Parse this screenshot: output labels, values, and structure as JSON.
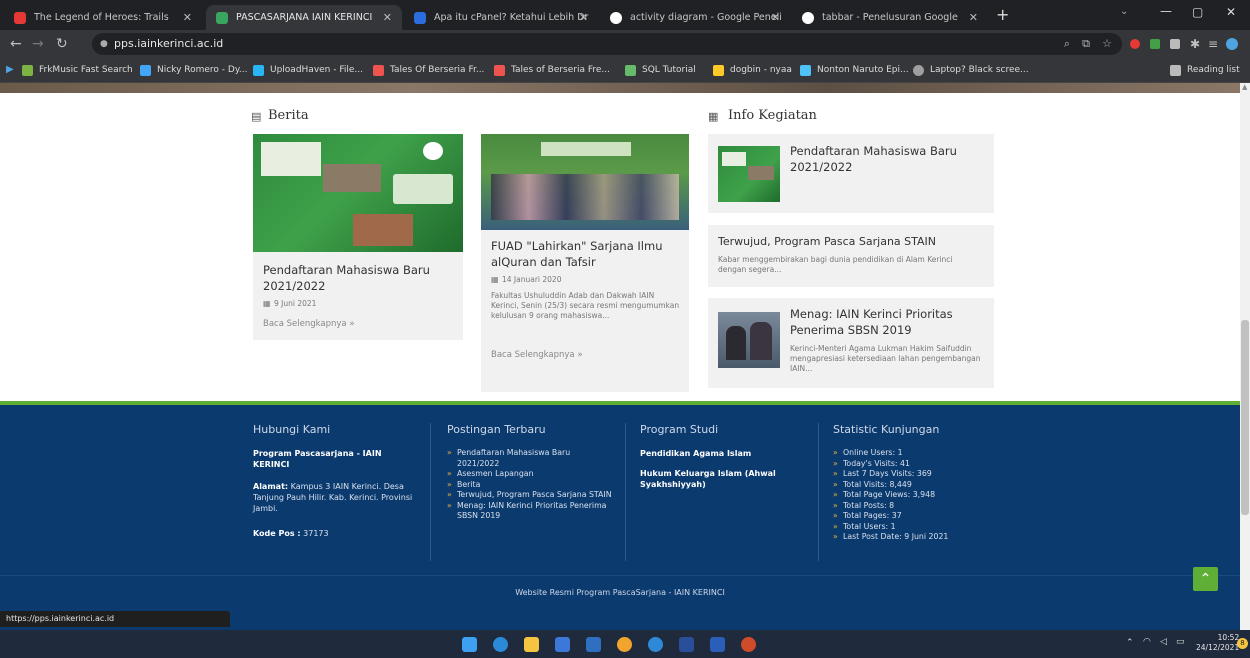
{
  "browser": {
    "tabs": [
      {
        "title": "The Legend of Heroes: Trails",
        "color": "#e53935"
      },
      {
        "title": "PASCASARJANA IAIN KERINCI",
        "color": "#3aa55f"
      },
      {
        "title": "Apa itu cPanel? Ketahui Lebih Dr",
        "color": "#2d6cdf"
      },
      {
        "title": "activity diagram - Google Peneli",
        "color": "#ffffff"
      },
      {
        "title": "tabbar - Penelusuran Google",
        "color": "#ffffff"
      }
    ],
    "url": "pps.iainkerinci.ac.id",
    "bookmarks": [
      {
        "label": "FrkMusic Fast Search",
        "color": "#7cb342"
      },
      {
        "label": "Nicky Romero - Dy...",
        "color": "#42a5f5"
      },
      {
        "label": "UploadHaven - File...",
        "color": "#29b6f6"
      },
      {
        "label": "Tales Of Berseria Fr...",
        "color": "#ef5350"
      },
      {
        "label": "Tales of Berseria Fre...",
        "color": "#ef5350"
      },
      {
        "label": "SQL Tutorial",
        "color": "#66bb6a"
      },
      {
        "label": "dogbin - nyaa",
        "color": "#ffca28"
      },
      {
        "label": "Nonton Naruto Epi...",
        "color": "#4fc3f7"
      },
      {
        "label": "Laptop? Black scree...",
        "color": "#9e9e9e"
      }
    ],
    "reading_list": "Reading list"
  },
  "berita": {
    "heading": "Berita",
    "cards": [
      {
        "title": "Pendaftaran Mahasiswa Baru 2021/2022",
        "date": "9 Juni 2021",
        "excerpt": "",
        "more": "Baca Selengkapnya »"
      },
      {
        "title": "FUAD \"Lahirkan\" Sarjana Ilmu alQuran dan Tafsir",
        "date": "14 Januari 2020",
        "excerpt": "Fakultas Ushuluddin Adab dan Dakwah IAIN Kerinci, Senin (25/3) secara resmi mengumumkan kelulusan 9 orang mahasiswa...",
        "more": "Baca Selengkapnya »"
      }
    ]
  },
  "info": {
    "heading": "Info Kegiatan",
    "items": [
      {
        "title": "Pendaftaran Mahasiswa Baru 2021/2022",
        "excerpt": ""
      },
      {
        "title": "Terwujud, Program Pasca Sarjana STAIN",
        "excerpt": "Kabar menggembirakan bagi dunia pendidikan di Alam Kerinci dengan segera..."
      },
      {
        "title": "Menag: IAIN Kerinci Prioritas Penerima SBSN 2019",
        "excerpt": "Kerinci-Menteri Agama Lukman Hakim Saifuddin mengapresiasi ketersediaan lahan pengembangan IAIN..."
      }
    ]
  },
  "footer": {
    "contact": {
      "heading": "Hubungi Kami",
      "org": "Program Pascasarjana - IAIN KERINCI",
      "address_label": "Alamat:",
      "address": "Kampus 3 IAIN Kerinci. Desa Tanjung Pauh Hilir. Kab. Kerinci. Provinsi Jambi.",
      "postal_label": "Kode Pos :",
      "postal": "37173"
    },
    "recent": {
      "heading": "Postingan Terbaru",
      "items": [
        "Pendaftaran Mahasiswa Baru 2021/2022",
        "Asesmen Lapangan",
        "Berita",
        "Terwujud, Program Pasca Sarjana STAIN",
        "Menag: IAIN Kerinci Prioritas Penerima SBSN 2019"
      ]
    },
    "programs": {
      "heading": "Program Studi",
      "items": [
        "Pendidikan Agama Islam",
        "Hukum Keluarga Islam (Ahwal Syakhshiyyah)"
      ]
    },
    "stats": {
      "heading": "Statistic Kunjungan",
      "items": [
        "Online Users: 1",
        "Today's Visits: 41",
        "Last 7 Days Visits: 369",
        "Total Visits: 8,449",
        "Total Page Views: 3,948",
        "Total Posts: 8",
        "Total Pages: 37",
        "Total Users: 1",
        "Last Post Date: 9 Juni 2021"
      ]
    },
    "copyright": "Website Resmi Program PascaSarjana - IAIN KERINCI"
  },
  "status_url": "https://pps.iainkerinci.ac.id",
  "taskbar": {
    "time": "10:52",
    "date": "24/12/2021",
    "notif": "8"
  },
  "colors": {
    "footer_bg": "#0b3a6e",
    "accent_green": "#5fae36",
    "card_bg": "#f1f1f1"
  }
}
